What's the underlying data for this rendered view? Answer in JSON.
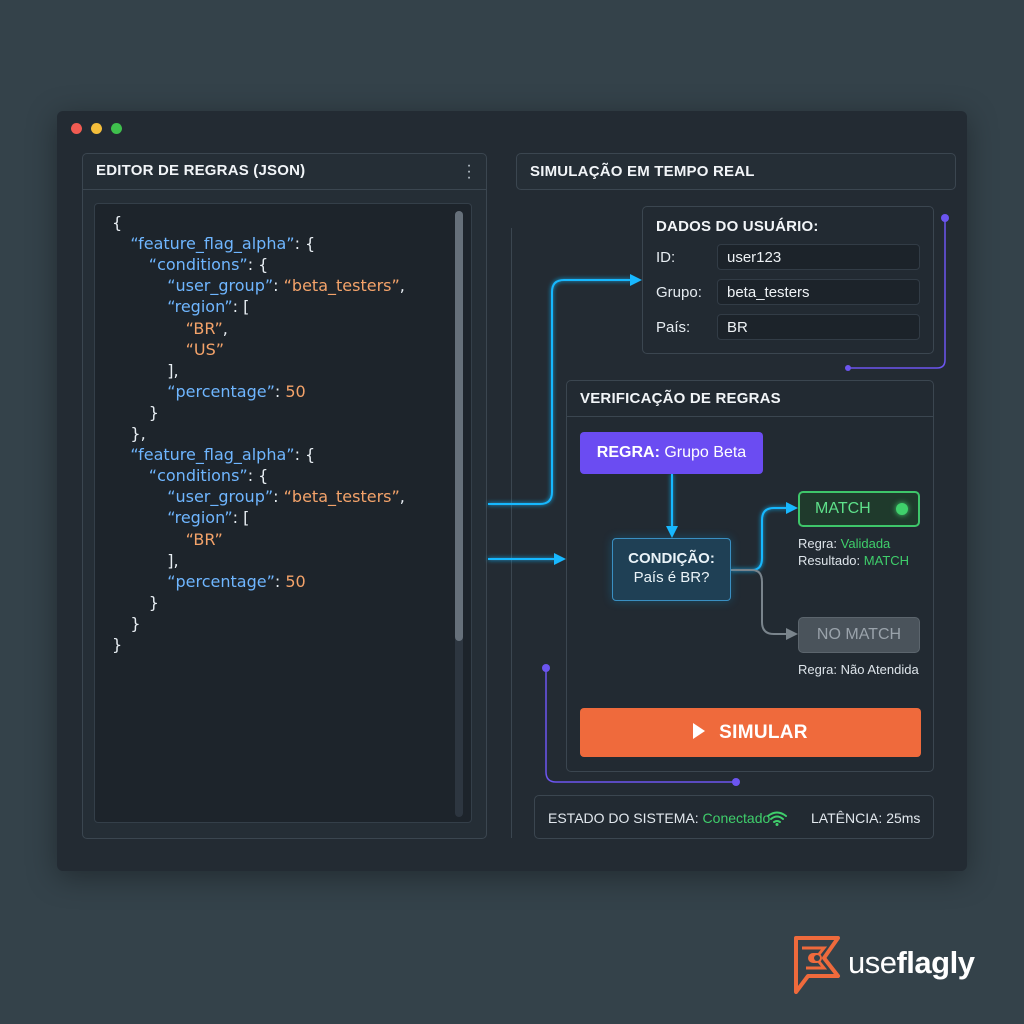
{
  "window": {
    "controls": [
      "close",
      "minimize",
      "maximize"
    ]
  },
  "editor": {
    "title": "EDITOR DE REGRAS (JSON)",
    "menu_icon": "kebab-menu-icon",
    "lines": [
      "{",
      "  \"feature_flag_alpha\": {",
      "    \"conditions\": {",
      "      \"user_group\": \"beta_testers\",",
      "      \"region\": [",
      "        \"BR\",",
      "        \"US\"",
      "      ],",
      "      \"percentage\": 50",
      "    }",
      "  },",
      "  \"feature_flag_alpha\": {",
      "    \"conditions\": {",
      "      \"user_group\": \"beta_testers\",",
      "      \"region\": [",
      "        \"BR\"",
      "      ],",
      "      \"percentage\": 50",
      "    }",
      "  }",
      "}"
    ]
  },
  "simulation": {
    "title": "SIMULAÇÃO EM TEMPO REAL",
    "user_data": {
      "title": "DADOS DO USUÁRIO:",
      "fields": [
        {
          "label": "ID:",
          "value": "user123"
        },
        {
          "label": "Grupo:",
          "value": "beta_testers"
        },
        {
          "label": "País:",
          "value": "BR"
        }
      ]
    },
    "rules_check": {
      "title": "VERIFICAÇÃO DE REGRAS",
      "rule_label": "REGRA:",
      "rule_value": "Grupo Beta",
      "condition_label": "CONDIÇÃO:",
      "condition_value": "País é BR?",
      "match_label": "MATCH",
      "match_rule_label": "Regra:",
      "match_rule_value": "Validada",
      "match_result_label": "Resultado:",
      "match_result_value": "MATCH",
      "no_match_label": "NO MATCH",
      "no_match_rule": "Regra: Não Atendida"
    },
    "simulate_button": "SIMULAR",
    "status": {
      "label": "ESTADO DO SISTEMA:",
      "value": "Conectado",
      "latency": "LATÊNCIA: 25ms"
    }
  },
  "brand": {
    "name_prefix": "use",
    "name_suffix": "flagly"
  },
  "colors": {
    "accent_orange": "#ef6a3c",
    "rule_purple": "#6b4cf2",
    "match_green": "#3fce6b",
    "flow_cyan": "#18b8ff"
  }
}
